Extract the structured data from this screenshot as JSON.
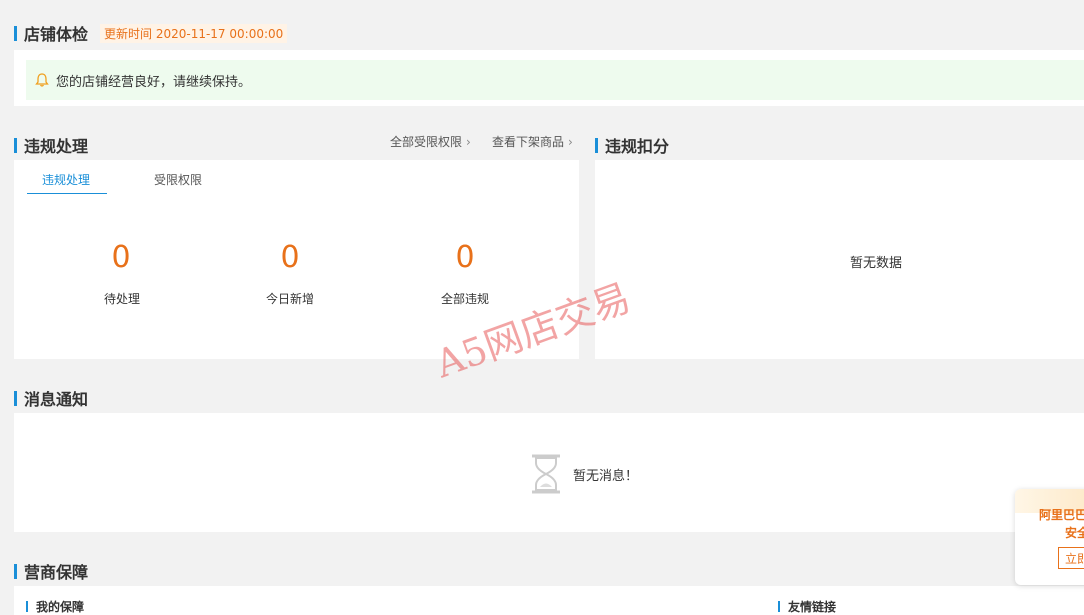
{
  "health": {
    "title": "店铺体检",
    "update_time": "更新时间 2020-11-17 00:00:00",
    "notice": "您的店铺经营良好，请继续保持。"
  },
  "violations": {
    "title": "违规处理",
    "link_all_restricted": "全部受限权限",
    "link_delisted": "查看下架商品",
    "tabs": [
      {
        "label": "违规处理",
        "active": true
      },
      {
        "label": "受限权限",
        "active": false
      }
    ],
    "stats": [
      {
        "value": "0",
        "label": "待处理"
      },
      {
        "value": "0",
        "label": "今日新增"
      },
      {
        "value": "0",
        "label": "全部违规"
      }
    ]
  },
  "deductions": {
    "title": "违规扣分",
    "empty": "暂无数据"
  },
  "messages": {
    "title": "消息通知",
    "empty": "暂无消息！"
  },
  "guarantee": {
    "title": "营商保障",
    "my_guarantee": "我的保障",
    "friend_links": "友情链接"
  },
  "watermark": "A5网店交易",
  "float_card": {
    "line1": "阿里巴巴",
    "line2": "安全",
    "button": "立即"
  },
  "colors": {
    "accent_blue": "#1a8fd8",
    "accent_orange": "#e8711a",
    "notice_bg": "#eefbee"
  }
}
